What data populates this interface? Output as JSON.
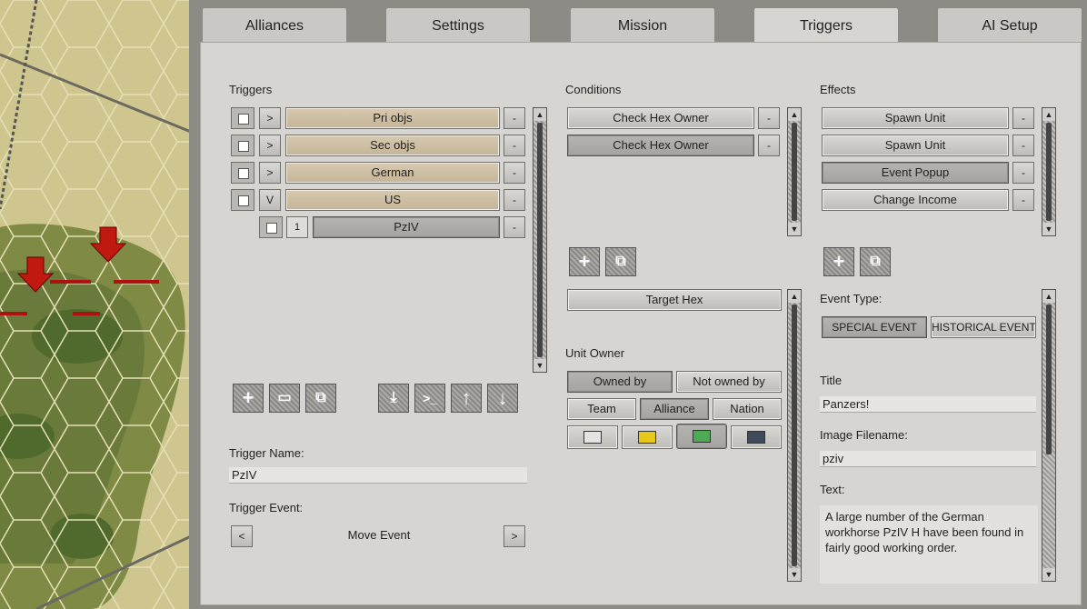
{
  "tabs": [
    "Alliances",
    "Settings",
    "Mission",
    "Triggers",
    "AI Setup"
  ],
  "triggers": {
    "label": "Triggers",
    "items": [
      {
        "toggle": ">",
        "name": "Pri objs"
      },
      {
        "toggle": ">",
        "name": "Sec objs"
      },
      {
        "toggle": ">",
        "name": "German"
      },
      {
        "toggle": "V",
        "name": "US"
      }
    ],
    "child": {
      "index": "1",
      "name": "PzIV"
    },
    "remove": "-",
    "name_label": "Trigger Name:",
    "name_value": "PzIV",
    "event_label": "Trigger Event:",
    "event_value": "Move Event",
    "prev": "<",
    "next": ">"
  },
  "conditions": {
    "label": "Conditions",
    "items": [
      "Check Hex Owner",
      "Check Hex Owner"
    ],
    "target_hex": "Target Hex",
    "unit_owner_label": "Unit Owner",
    "owned_by": "Owned by",
    "not_owned_by": "Not owned by",
    "team": "Team",
    "alliance": "Alliance",
    "nation": "Nation",
    "colors": [
      "#e3e3e3",
      "#e6c81a",
      "#4faa55",
      "#3f4a5a"
    ]
  },
  "effects": {
    "label": "Effects",
    "items": [
      "Spawn Unit",
      "Spawn Unit",
      "Event Popup",
      "Change Income"
    ],
    "event_type_label": "Event Type:",
    "special_event": "SPECIAL EVENT",
    "historical_event": "HISTORICAL EVENT",
    "title_label": "Title",
    "title_value": "Panzers!",
    "image_label": "Image Filename:",
    "image_value": "pziv",
    "text_label": "Text:",
    "text_value": "A large number of the German workhorse PzIV H have been found in fairly good working order."
  }
}
